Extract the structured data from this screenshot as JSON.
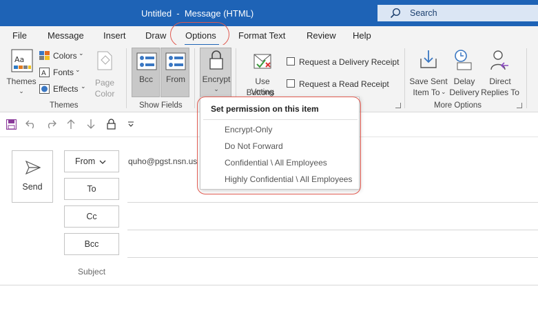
{
  "window": {
    "title": "Untitled  -  Message (HTML)"
  },
  "search": {
    "placeholder": "Search"
  },
  "tabs": [
    "File",
    "Message",
    "Insert",
    "Draw",
    "Options",
    "Format Text",
    "Review",
    "Help"
  ],
  "active_tab": "Options",
  "ribbon": {
    "themes": {
      "themes_label": "Themes",
      "colors_label": "Colors",
      "fonts_label": "Fonts",
      "effects_label": "Effects",
      "page_color_label_1": "Page",
      "page_color_label_2": "Color",
      "group": "Themes"
    },
    "show_fields": {
      "bcc_label": "Bcc",
      "from_label": "From",
      "group": "Show Fields"
    },
    "encrypt": {
      "label": "Encrypt"
    },
    "voting": {
      "label_1": "Use Voting",
      "label_2": "Buttons"
    },
    "tracking": {
      "delivery_receipt": "Request a Delivery Receipt",
      "read_receipt": "Request a Read Receipt"
    },
    "more_options": {
      "save_sent_1": "Save Sent",
      "save_sent_2": "Item To",
      "delay_1": "Delay",
      "delay_2": "Delivery",
      "direct_1": "Direct",
      "direct_2": "Replies To",
      "group": "More Options"
    }
  },
  "compose": {
    "send_label": "Send",
    "from_label": "From",
    "from_value": "quho@pgst.nsn.us",
    "to_label": "To",
    "cc_label": "Cc",
    "bcc_label": "Bcc",
    "subject_label": "Subject"
  },
  "encrypt_menu": {
    "heading": "Set permission on this item",
    "items": [
      "Encrypt-Only",
      "Do Not Forward",
      "Confidential \\ All Employees",
      "Highly Confidential \\ All Employees"
    ]
  },
  "colors": {
    "titlebar": "#1e63b6",
    "accent": "#1e63b6",
    "highlight_circle": "#e05a50",
    "ribbon_bg": "#f3f3f3"
  }
}
